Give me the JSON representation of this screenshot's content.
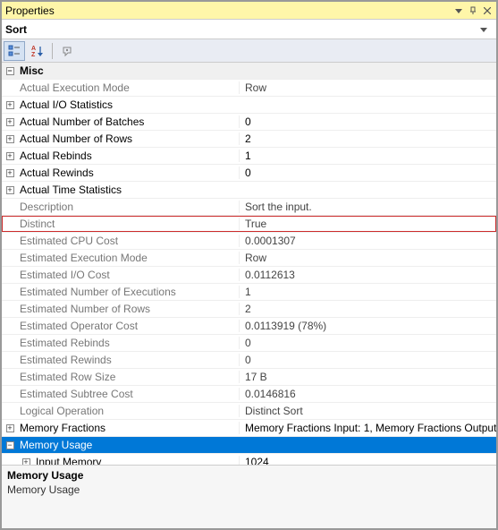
{
  "window": {
    "title": "Properties"
  },
  "selected_object": "Sort",
  "categories": [
    {
      "name": "Misc",
      "expanded": true,
      "rows": [
        {
          "label": "Actual Execution Mode",
          "value": "Row",
          "exp": "",
          "dim": true
        },
        {
          "label": "Actual I/O Statistics",
          "value": "",
          "exp": "+",
          "dim": false
        },
        {
          "label": "Actual Number of Batches",
          "value": "0",
          "exp": "+",
          "dim": false
        },
        {
          "label": "Actual Number of Rows",
          "value": "2",
          "exp": "+",
          "dim": false
        },
        {
          "label": "Actual Rebinds",
          "value": "1",
          "exp": "+",
          "dim": false
        },
        {
          "label": "Actual Rewinds",
          "value": "0",
          "exp": "+",
          "dim": false
        },
        {
          "label": "Actual Time Statistics",
          "value": "",
          "exp": "+",
          "dim": false
        },
        {
          "label": "Description",
          "value": "Sort the input.",
          "exp": "",
          "dim": true
        },
        {
          "label": "Distinct",
          "value": "True",
          "exp": "",
          "dim": true,
          "highlight": true
        },
        {
          "label": "Estimated CPU Cost",
          "value": "0.0001307",
          "exp": "",
          "dim": true
        },
        {
          "label": "Estimated Execution Mode",
          "value": "Row",
          "exp": "",
          "dim": true
        },
        {
          "label": "Estimated I/O Cost",
          "value": "0.0112613",
          "exp": "",
          "dim": true
        },
        {
          "label": "Estimated Number of Executions",
          "value": "1",
          "exp": "",
          "dim": true
        },
        {
          "label": "Estimated Number of Rows",
          "value": "2",
          "exp": "",
          "dim": true
        },
        {
          "label": "Estimated Operator Cost",
          "value": "0.0113919 (78%)",
          "exp": "",
          "dim": true
        },
        {
          "label": "Estimated Rebinds",
          "value": "0",
          "exp": "",
          "dim": true
        },
        {
          "label": "Estimated Rewinds",
          "value": "0",
          "exp": "",
          "dim": true
        },
        {
          "label": "Estimated Row Size",
          "value": "17 B",
          "exp": "",
          "dim": true
        },
        {
          "label": "Estimated Subtree Cost",
          "value": "0.0146816",
          "exp": "",
          "dim": true
        },
        {
          "label": "Logical Operation",
          "value": "Distinct Sort",
          "exp": "",
          "dim": true
        },
        {
          "label": "Memory Fractions",
          "value": "Memory Fractions Input: 1, Memory Fractions Output",
          "exp": "+",
          "dim": false
        },
        {
          "label": "Memory Usage",
          "value": "",
          "exp": "-",
          "dim": false,
          "selected": true,
          "children": [
            {
              "label": "Input Memory",
              "value": "1024",
              "exp": "+",
              "dim": false
            }
          ]
        }
      ]
    }
  ],
  "description_pane": {
    "title": "Memory Usage",
    "body": "Memory Usage"
  }
}
